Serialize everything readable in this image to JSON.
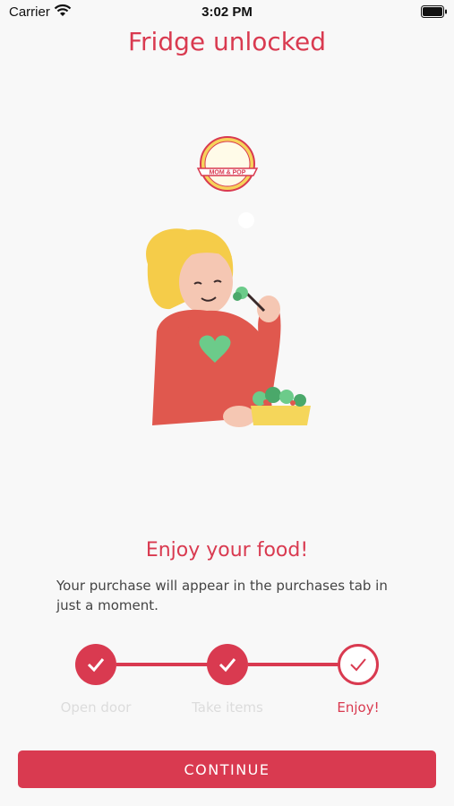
{
  "status_bar": {
    "carrier": "Carrier",
    "time": "3:02 PM"
  },
  "header": {
    "title": "Fridge unlocked"
  },
  "logo": {
    "text": "MOM & POP"
  },
  "main": {
    "heading": "Enjoy your food!",
    "description": "Your purchase will appear in the purchases tab in just a moment."
  },
  "stepper": {
    "steps": [
      {
        "label": "Open door",
        "state": "done"
      },
      {
        "label": "Take items",
        "state": "done"
      },
      {
        "label": "Enjoy!",
        "state": "current"
      }
    ]
  },
  "footer": {
    "continue_label": "CONTINUE"
  },
  "colors": {
    "accent": "#d93a50",
    "inactive_label": "#dcdcdc"
  }
}
